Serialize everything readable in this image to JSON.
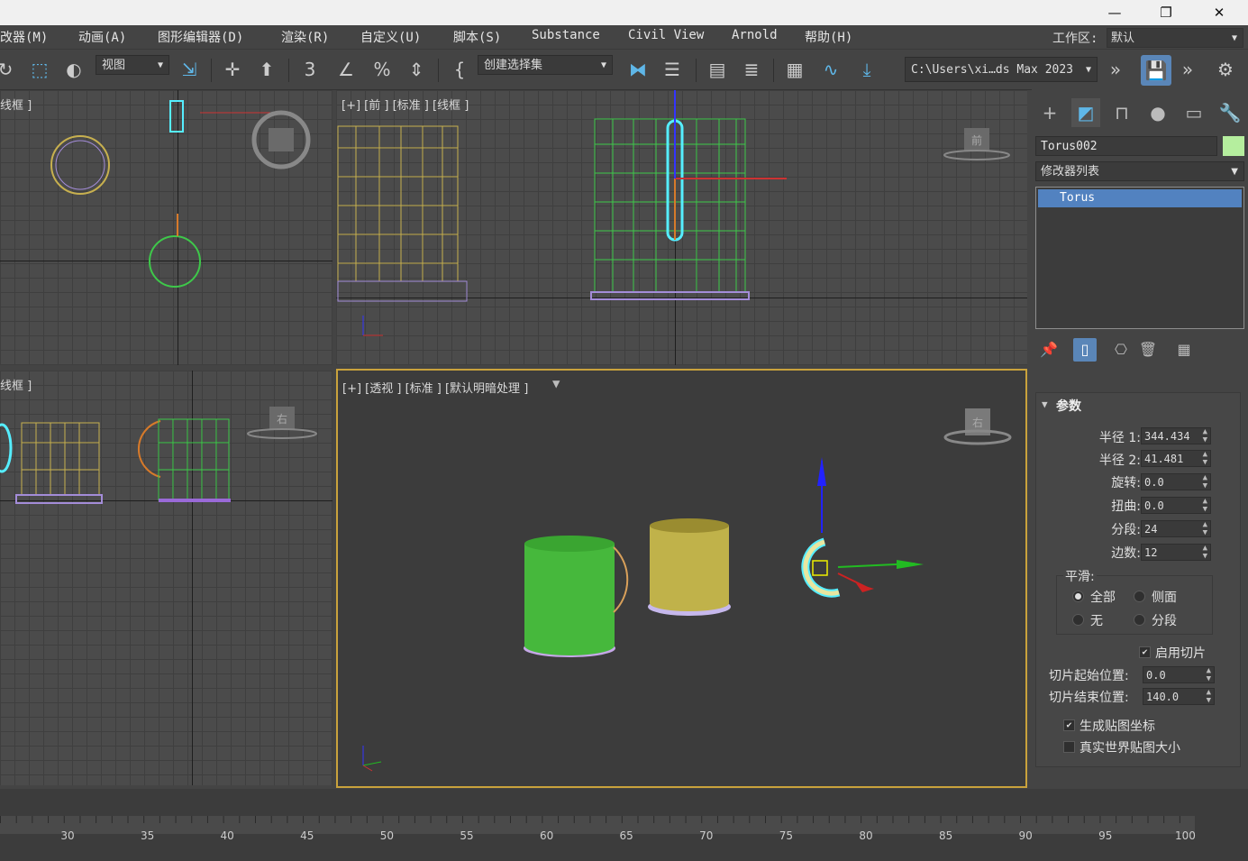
{
  "window": {
    "minimize": "—",
    "restore": "❐",
    "close": "✕"
  },
  "menu": {
    "items": [
      "改器(M)",
      "动画(A)",
      "图形编辑器(D)",
      "渲染(R)",
      "自定义(U)",
      "脚本(S)",
      "Substance",
      "Civil View",
      "Arnold",
      "帮助(H)"
    ],
    "workspace_label": "工作区:",
    "workspace_value": "默认"
  },
  "toolbar": {
    "view_dropdown": "视图",
    "selection_set": "创建选择集",
    "path": "C:\\Users\\xi…ds Max 2023"
  },
  "viewports": {
    "top": {
      "label": "线框 ]"
    },
    "front": {
      "label": "[+] [前 ] [标准 ] [线框 ]",
      "cube_label": "前"
    },
    "left": {
      "label": "线框 ]",
      "cube_label": "右"
    },
    "perspective": {
      "label": "[+] [透视 ] [标准 ] [默认明暗处理 ]",
      "cube_label": "右"
    }
  },
  "command_panel": {
    "object_name": "Torus002",
    "object_color": "#b5ee9e",
    "modifier_list": "修改器列表",
    "stack_items": [
      "Torus"
    ],
    "rollout_title": "参数",
    "params": [
      {
        "label": "半径 1:",
        "value": "344.434"
      },
      {
        "label": "半径 2:",
        "value": "41.481"
      },
      {
        "label": "旋转:",
        "value": "0.0"
      },
      {
        "label": "扭曲:",
        "value": "0.0"
      },
      {
        "label": "分段:",
        "value": "24"
      },
      {
        "label": "边数:",
        "value": "12"
      }
    ],
    "smooth_label": "平滑:",
    "smooth_options": [
      "全部",
      "侧面",
      "无",
      "分段"
    ],
    "smooth_selected": "全部",
    "slice_on_label": "启用切片",
    "slice_from_label": "切片起始位置:",
    "slice_from_value": "0.0",
    "slice_to_label": "切片结束位置:",
    "slice_to_value": "140.0",
    "gen_map_label": "生成贴图坐标",
    "real_world_label": "真实世界贴图大小"
  },
  "timeline": {
    "ticks": [
      "30",
      "35",
      "40",
      "45",
      "50",
      "55",
      "60",
      "65",
      "70",
      "75",
      "80",
      "85",
      "90",
      "95",
      "100"
    ]
  }
}
